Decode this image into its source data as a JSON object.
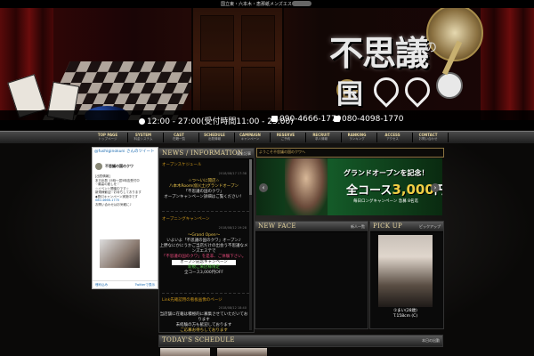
{
  "topbar": {
    "title": "国立東・六本木・恵那紙メンズエステ",
    "search": ""
  },
  "header": {
    "logo_main": "不思議",
    "logo_small": "の",
    "logo_bottom": "国"
  },
  "infobar": {
    "hours": "12:00 - 27:00(受付時間11:00 - 25:00)",
    "phone1": "090-4666-1770",
    "phone2": "080-4098-1770"
  },
  "nav": [
    {
      "en": "TOP PAGE",
      "jp": "トップページ"
    },
    {
      "en": "SYSTEM",
      "jp": "料金システム"
    },
    {
      "en": "CAST",
      "jp": "在籍一覧"
    },
    {
      "en": "SCHEDULE",
      "jp": "出勤情報"
    },
    {
      "en": "CAMPAIGN",
      "jp": "キャンペーン"
    },
    {
      "en": "RESERVE",
      "jp": "ご予約"
    },
    {
      "en": "RECRUIT",
      "jp": "求人情報"
    },
    {
      "en": "RANKING",
      "jp": "ランキング"
    },
    {
      "en": "ACCESS",
      "jp": "アクセス"
    },
    {
      "en": "CONTACT",
      "jp": "お問い合わせ"
    }
  ],
  "twitter": {
    "header": "@fushiginokuni さんのツイート",
    "account": "不思議の国のクワ",
    "lines": [
      "[出勤情報]",
      "本日出勤 15時〜翌5時迄受付中",
      "♡最高の癒しを♡",
      "☆イベント開催中です☆",
      "新規様歓迎♡お待ちしております",
      "◆割引キャンペーン実施中です",
      "080-4666-1770",
      "お問い合わせはお気軽に♪"
    ],
    "footer_left": "埋め込み",
    "footer_right": "Twitterで表示"
  },
  "news": {
    "title": "NEWS / INFORMATION",
    "more": "過去記事",
    "items": [
      {
        "sub": "オープンスケジュール",
        "date": "2018/08/17 17:38",
        "lines": [
          "☆つ〜いに開店☆",
          "八本木Room(仮)(土)グランドオープン",
          "「不思議の国のクワ」",
          "オープンキャンペーン詳細はご覧ください！"
        ]
      },
      {
        "sub": "オープニングキャンペーン",
        "date": "2018/08/12 19:28",
        "lines": [
          "〜Grand Open〜",
          "いよいよ「不思議の国のクワ」オープン♪",
          "上野なにかにうかご当店だけの出会う不思議なメンズエステで",
          "「不思議の国のクワ」を是非、ご体験下さい。",
          "オープン記念キャンペーン",
          "新規ご来店様限定",
          "全コース3,000円OFF"
        ]
      },
      {
        "sub": "Link先確認用の看板画像のページ",
        "date": "2018/08/12 18:40",
        "lines": [
          "当店舗に在籍は積極的に募集させていただいております",
          "未経験の方も歓迎しております",
          "ご応募お待ちしております"
        ]
      }
    ]
  },
  "crumb": "ようこそ不思議の国のクワへ",
  "slider": {
    "line1": "グランドオープンを記念！",
    "line2_pre": "全コース",
    "line2_price": "3,000",
    "line2_post": "円OFF!!",
    "line3": "毎日ロングキャンペーン 急募 8名迄"
  },
  "newface": {
    "title": "NEW FACE",
    "more": "新人一覧"
  },
  "pickup": {
    "title": "PICK UP",
    "more": "ピックアップ",
    "name": "①まい(28歳)",
    "spec": "T.158cm (C)"
  },
  "schedule": {
    "title": "TODAY'S SCHEDULE",
    "more": "本日の出勤"
  }
}
